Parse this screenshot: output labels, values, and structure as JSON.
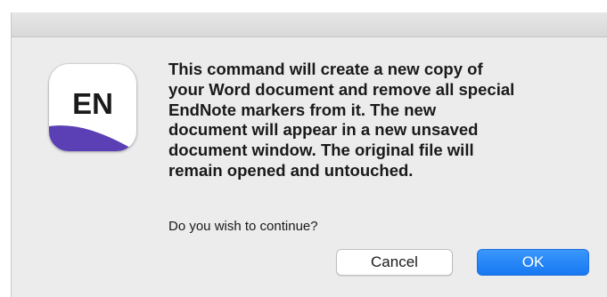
{
  "dialog": {
    "app_icon": {
      "name": "endnote-app-icon",
      "label": "EN",
      "accent_color": "#5b3fb5"
    },
    "message_lines": [
      "This command will create a new copy of",
      "your Word document and remove all special",
      "EndNote markers from it. The new",
      "document will appear in a new unsaved",
      "document window. The original file will",
      "remain opened and untouched."
    ],
    "question": "Do you wish to continue?",
    "buttons": {
      "cancel_label": "Cancel",
      "ok_label": "OK"
    },
    "colors": {
      "ok_button": "#1778f2",
      "background": "#ececec"
    }
  }
}
